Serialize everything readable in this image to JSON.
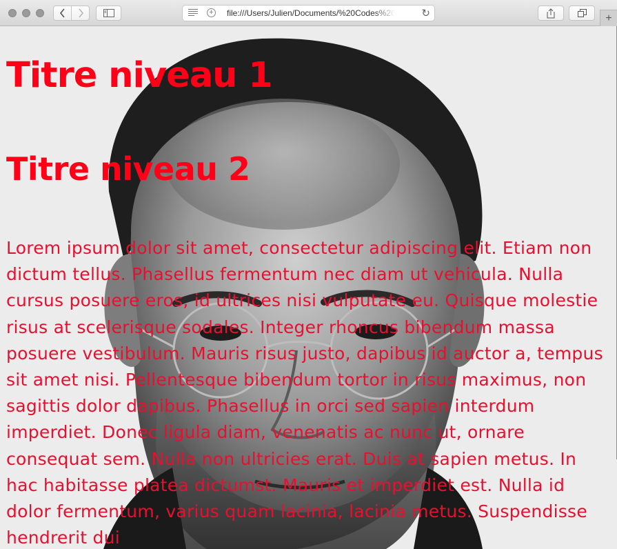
{
  "browser": {
    "address_url": "file:///Users/Julien/Documents/%20Codes%20",
    "icons": {
      "back": "chevron-left-icon",
      "forward": "chevron-right-icon",
      "sidebar": "sidebar-icon",
      "reader": "reader-icon",
      "add": "plus-circle-icon",
      "reload": "reload-icon",
      "share": "share-icon",
      "tabs": "tabs-overview-icon",
      "new_tab": "plus-icon"
    }
  },
  "page": {
    "heading1": "Titre niveau 1",
    "heading2": "Titre niveau 2",
    "paragraph": "Lorem ipsum dolor sit amet, consectetur adipiscing elit. Etiam non dictum tellus. Phasellus fermentum nec diam ut vehicula. Nulla cursus posuere eros, id ultrices nisi vulputate eu. Quisque molestie risus at scelerisque sodales. Integer rhoncus bibendum massa posuere vestibulum. Mauris risus justo, dapibus id auctor a, tempus sit amet nisi. Pellentesque bibendum tortor in risus maximus, non sagittis dolor dapibus. Phasellus in orci sed sapien interdum imperdiet. Donec ligula diam, venenatis ac nunc ut, ornare consequat sem. Nulla non ultricies erat. Duis at sapien metus. In hac habitasse platea dictumst. Mauris et imperdiet est. Nulla id dolor fermentum, varius quam lacinia, lacinia metus. Suspendisse hendrerit dui",
    "colors": {
      "heading": "#ff0018",
      "text": "#e8102f",
      "background": "#ececec"
    },
    "background_image": "black-and-white-portrait-photo"
  }
}
